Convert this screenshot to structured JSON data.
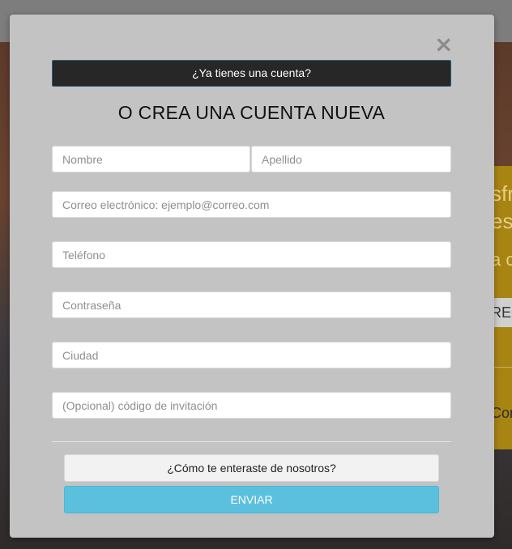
{
  "background": {
    "panel_lines": [
      "sfr",
      "es",
      "a c"
    ],
    "panel_button_1": "REG",
    "panel_button_2": "Con"
  },
  "modal": {
    "close_symbol": "×",
    "login_prompt": "¿Ya tienes una cuenta?",
    "title": "O CREA UNA CUENTA NUEVA",
    "fields": {
      "first_name": {
        "placeholder": "Nombre",
        "value": ""
      },
      "last_name": {
        "placeholder": "Apellido",
        "value": ""
      },
      "email": {
        "placeholder": "Correo electrónico: ejemplo@correo.com",
        "value": ""
      },
      "phone": {
        "placeholder": "Teléfono",
        "value": ""
      },
      "password": {
        "placeholder": "Contraseña",
        "value": ""
      },
      "city": {
        "placeholder": "Ciudad",
        "value": ""
      },
      "invite_code": {
        "placeholder": "(Opcional) código de invitación",
        "value": ""
      }
    },
    "source_label": "¿Cómo te enteraste de nosotros?",
    "submit_label": "ENVIAR"
  },
  "colors": {
    "modal_bg": "#c3c3c3",
    "login_bar_bg": "#272727",
    "submit_bg": "#5bc0de",
    "accent_panel": "#a88412"
  }
}
